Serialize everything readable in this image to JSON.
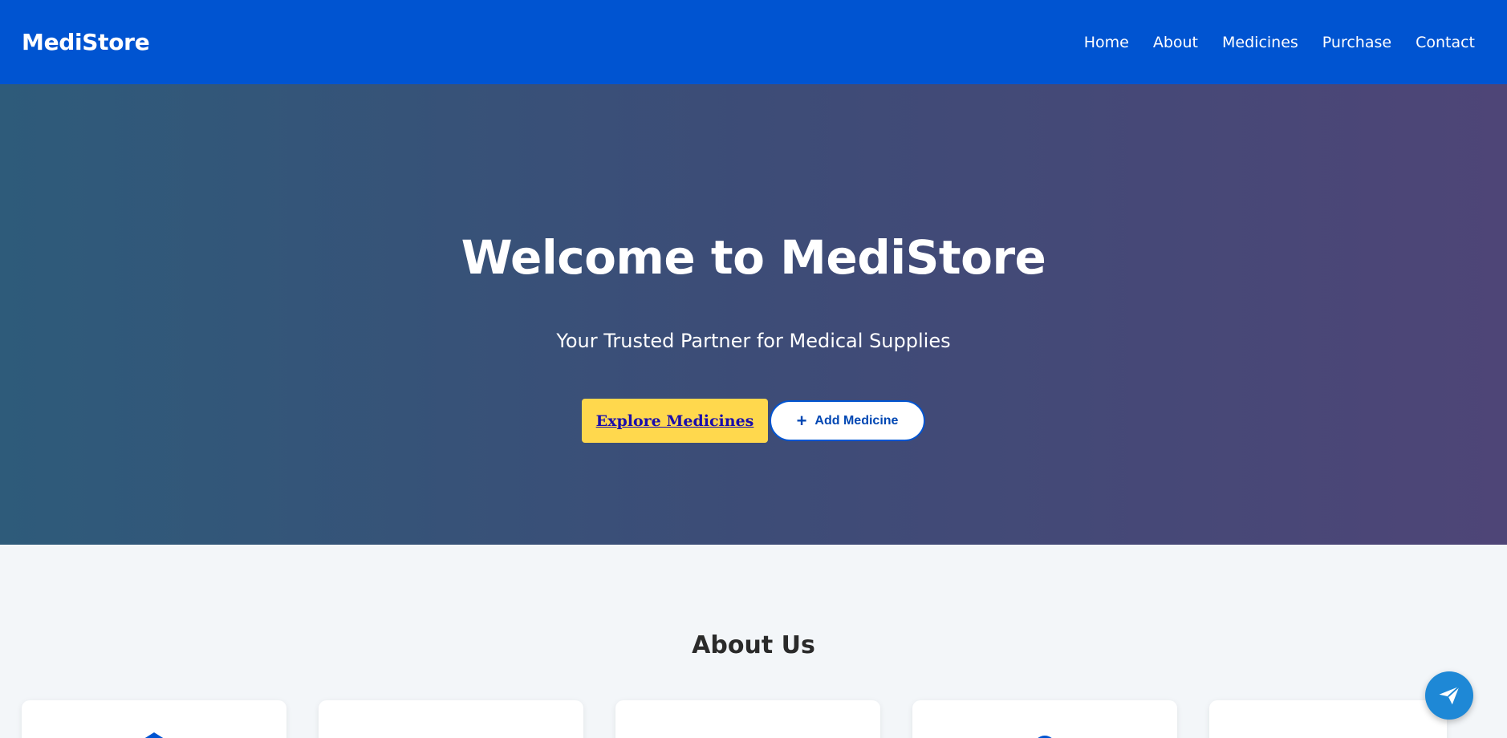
{
  "navbar": {
    "brand": "MediStore",
    "links": [
      "Home",
      "About",
      "Medicines",
      "Purchase",
      "Contact"
    ]
  },
  "hero": {
    "title": "Welcome to MediStore",
    "subtitle": "Your Trusted Partner for Medical Supplies",
    "explore_button": "Explore Medicines",
    "add_button": "Add Medicine"
  },
  "about": {
    "title": "About Us",
    "card_icons": [
      "graduation-cap-icon",
      "info-icon",
      "user-icon",
      "globe-icon",
      "calendar-icon"
    ]
  },
  "chat": {
    "icon": "paper-plane-icon"
  },
  "colors": {
    "navbar": "#0054d1",
    "explore_button": "#ffd84d",
    "fab": "#1e88d6"
  }
}
